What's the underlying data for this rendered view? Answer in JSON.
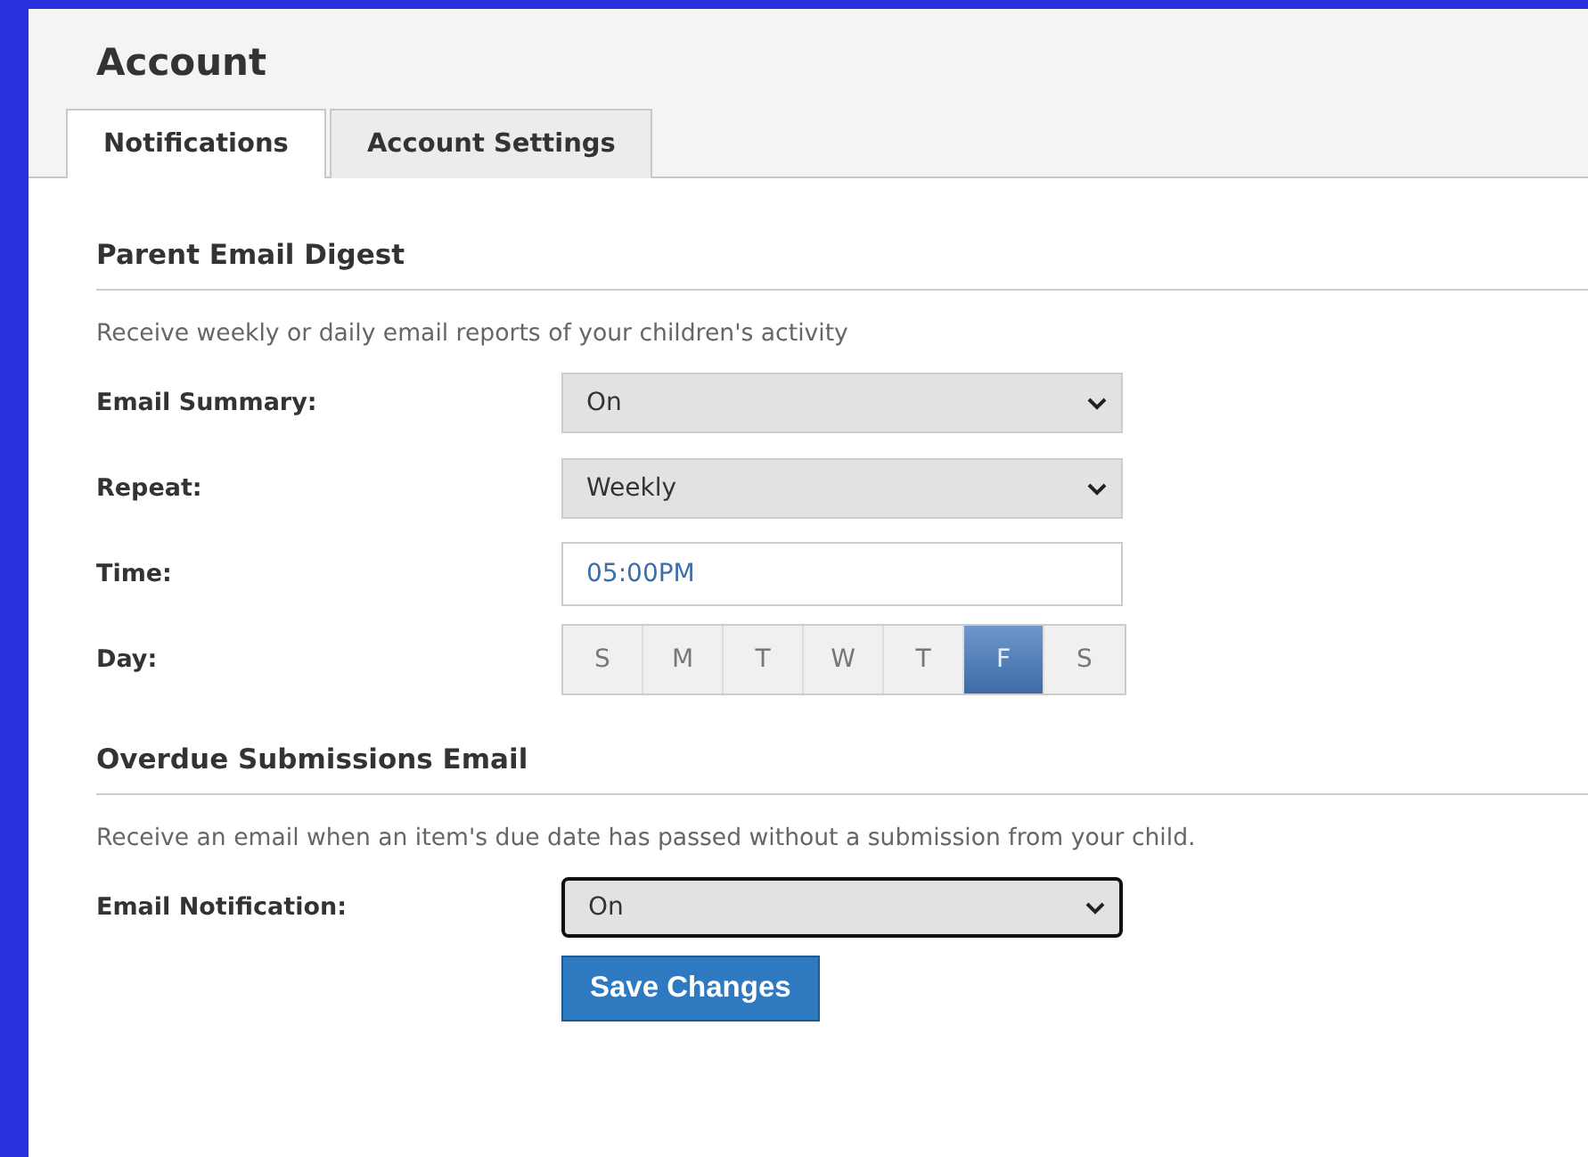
{
  "page": {
    "title": "Account"
  },
  "tabs": [
    {
      "label": "Notifications",
      "selected": true
    },
    {
      "label": "Account Settings",
      "selected": false
    }
  ],
  "sections": [
    {
      "title": "Parent Email Digest",
      "description": "Receive weekly or daily email reports of your children's activity",
      "fields": [
        {
          "kind": "select",
          "label": "Email Summary:",
          "value": "On",
          "focused": false
        },
        {
          "kind": "select",
          "label": "Repeat:",
          "value": "Weekly",
          "focused": false
        },
        {
          "kind": "text",
          "label": "Time:",
          "value": "05:00PM"
        },
        {
          "kind": "days",
          "label": "Day:",
          "days": [
            {
              "label": "S",
              "selected": false
            },
            {
              "label": "M",
              "selected": false
            },
            {
              "label": "T",
              "selected": false
            },
            {
              "label": "W",
              "selected": false
            },
            {
              "label": "T",
              "selected": false
            },
            {
              "label": "F",
              "selected": true
            },
            {
              "label": "S",
              "selected": false
            }
          ]
        }
      ]
    },
    {
      "title": "Overdue Submissions Email",
      "description": "Receive an email when an item's due date has passed without a submission from your child.",
      "fields": [
        {
          "kind": "select",
          "label": "Email Notification:",
          "value": "On",
          "focused": true
        }
      ]
    }
  ],
  "save_button": "Save Changes"
}
